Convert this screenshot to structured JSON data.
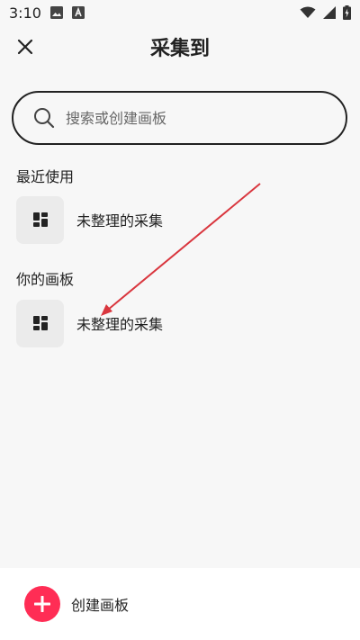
{
  "status_bar": {
    "time": "3:10",
    "icons": [
      "image-icon",
      "font-icon",
      "wifi-icon",
      "signal-icon",
      "battery-charging-icon"
    ]
  },
  "header": {
    "title": "采集到",
    "close_icon": "close-icon"
  },
  "search": {
    "placeholder": "搜索或创建画板",
    "value": "",
    "icon": "search-icon"
  },
  "recent": {
    "title": "最近使用",
    "items": [
      {
        "label": "未整理的采集",
        "icon": "board-grid-icon"
      }
    ]
  },
  "boards": {
    "title": "你的画板",
    "items": [
      {
        "label": "未整理的采集",
        "icon": "board-grid-icon"
      }
    ]
  },
  "footer": {
    "create_label": "创建画板",
    "icon": "plus-icon"
  },
  "colors": {
    "accent": "#ff2d55",
    "annotation_arrow": "#d9363e",
    "background": "#f7f7f7",
    "thumb_bg": "#ebebeb"
  }
}
